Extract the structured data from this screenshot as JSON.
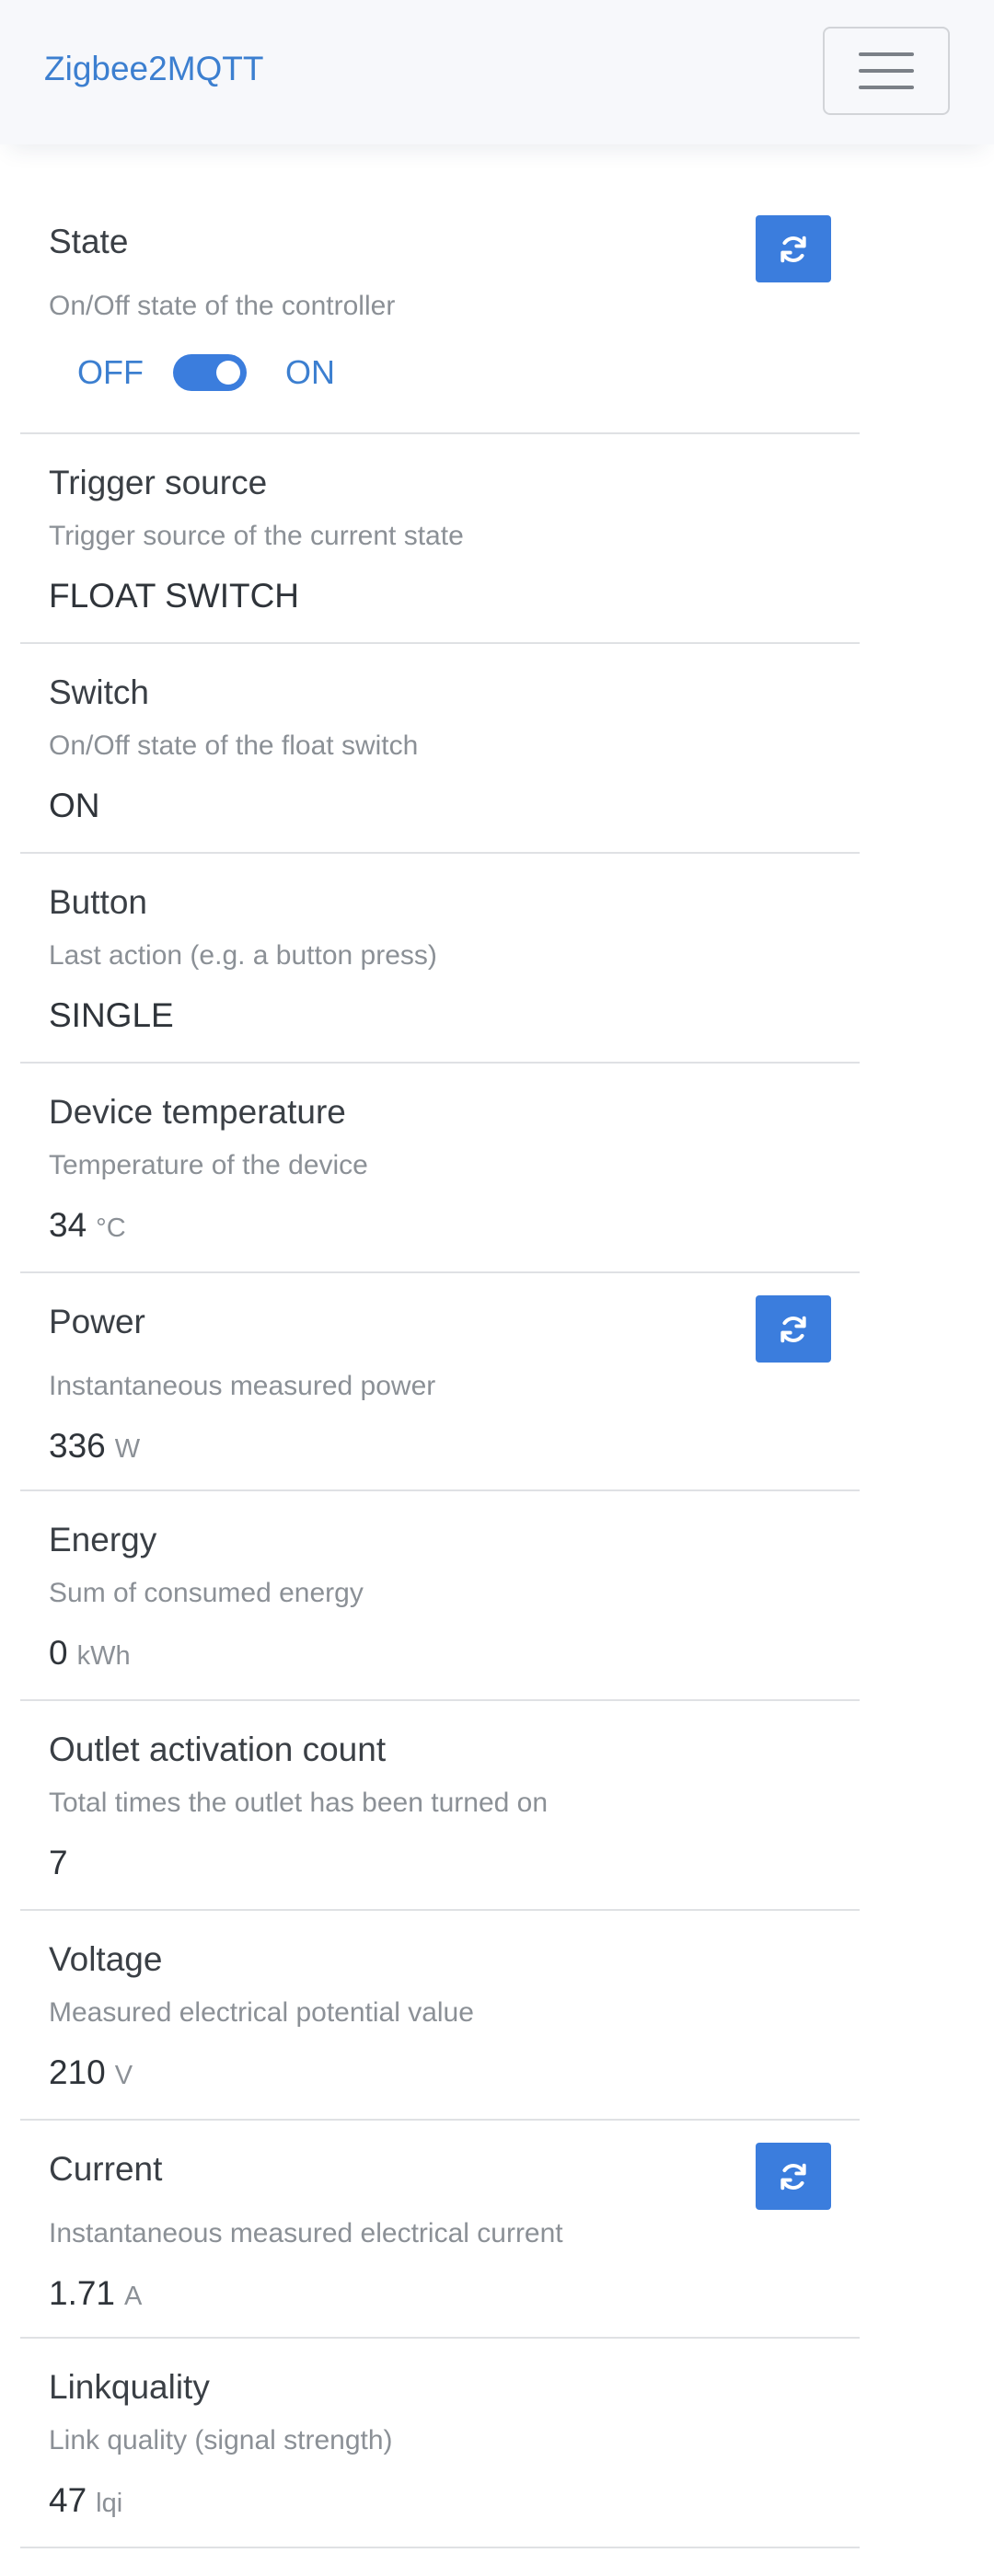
{
  "app": {
    "brand": "Zigbee2MQTT"
  },
  "features": [
    {
      "title": "State",
      "description": "On/Off state of the controller",
      "off_label": "OFF",
      "on_label": "ON",
      "switch_on": true
    },
    {
      "title": "Trigger source",
      "description": "Trigger source of the current state",
      "value": "FLOAT SWITCH"
    },
    {
      "title": "Switch",
      "description": "On/Off state of the float switch",
      "value": "ON"
    },
    {
      "title": "Button",
      "description": "Last action (e.g. a button press)",
      "value": "SINGLE"
    },
    {
      "title": "Device temperature",
      "description": "Temperature of the device",
      "value": "34",
      "unit": "°C"
    },
    {
      "title": "Power",
      "description": "Instantaneous measured power",
      "value": "336",
      "unit": "W"
    },
    {
      "title": "Energy",
      "description": "Sum of consumed energy",
      "value": "0",
      "unit": "kWh"
    },
    {
      "title": "Outlet activation count",
      "description": "Total times the outlet has been turned on",
      "value": "7"
    },
    {
      "title": "Voltage",
      "description": "Measured electrical potential value",
      "value": "210",
      "unit": "V"
    },
    {
      "title": "Current",
      "description": "Instantaneous measured electrical current",
      "value": "1.71",
      "unit": "A"
    },
    {
      "title": "Linkquality",
      "description": "Link quality (signal strength)",
      "value": "47",
      "unit": "lqi"
    }
  ],
  "colors": {
    "accent": "#3b7ddd",
    "brand": "#3c7fd0",
    "text": "#3a3f45",
    "muted": "#8b9096",
    "divider": "#dfe1e4"
  },
  "icons": {
    "menu": "hamburger-icon",
    "refresh": "sync-arrows-icon"
  }
}
